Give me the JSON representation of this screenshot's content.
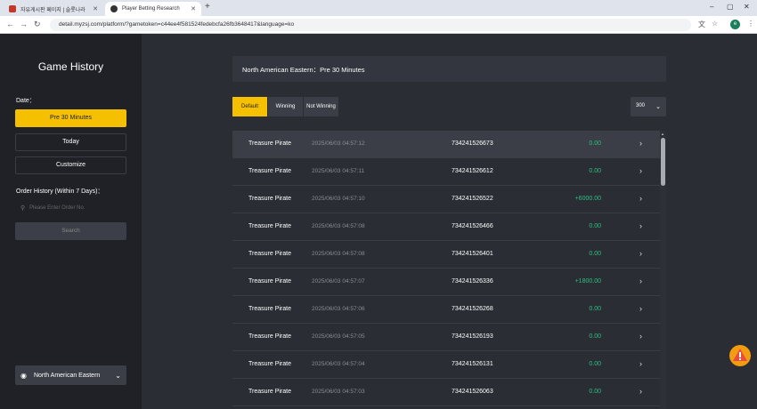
{
  "browser": {
    "tabs": [
      {
        "label": "자유게시판 페이지 | 슬롯나라"
      },
      {
        "label": "Player Betting Research"
      }
    ],
    "url": "detail.myzsj.com/platform/?gametoken=c44ee4f581524fedebcfa26fb3648417&language=ko",
    "profile_initial": "e"
  },
  "sidebar": {
    "title": "Game History",
    "date_label": "Date：",
    "date_options": [
      "Pre 30 Minutes",
      "Today",
      "Customize"
    ],
    "order_label": "Order History (Within 7 Days)：",
    "order_placeholder": "Please Enter Order No.",
    "search_label": "Search",
    "timezone": "North American Eastern"
  },
  "main": {
    "header": "North American Eastern：Pre 30 Minutes",
    "filters": [
      "Default",
      "Winning",
      "Not Winning"
    ],
    "page_size": "300",
    "rows": [
      {
        "game": "Treasure Pirate",
        "time": "2025/06/03 04:57:12",
        "id": "734241526673",
        "amount": "0.00"
      },
      {
        "game": "Treasure Pirate",
        "time": "2025/06/03 04:57:11",
        "id": "734241526612",
        "amount": "0.00"
      },
      {
        "game": "Treasure Pirate",
        "time": "2025/06/03 04:57:10",
        "id": "734241526522",
        "amount": "+6000.00"
      },
      {
        "game": "Treasure Pirate",
        "time": "2025/06/03 04:57:08",
        "id": "734241526466",
        "amount": "0.00"
      },
      {
        "game": "Treasure Pirate",
        "time": "2025/06/03 04:57:08",
        "id": "734241526401",
        "amount": "0.00"
      },
      {
        "game": "Treasure Pirate",
        "time": "2025/06/03 04:57:07",
        "id": "734241526336",
        "amount": "+1800.00"
      },
      {
        "game": "Treasure Pirate",
        "time": "2025/06/03 04:57:06",
        "id": "734241526268",
        "amount": "0.00"
      },
      {
        "game": "Treasure Pirate",
        "time": "2025/06/03 04:57:05",
        "id": "734241526193",
        "amount": "0.00"
      },
      {
        "game": "Treasure Pirate",
        "time": "2025/06/03 04:57:04",
        "id": "734241526131",
        "amount": "0.00"
      },
      {
        "game": "Treasure Pirate",
        "time": "2025/06/03 04:57:03",
        "id": "734241526063",
        "amount": "0.00"
      }
    ]
  },
  "colors": {
    "accent": "#f5c000",
    "win": "#2bc07e",
    "sidebar_bg": "#1f2127",
    "page_bg": "#2a2d34"
  }
}
